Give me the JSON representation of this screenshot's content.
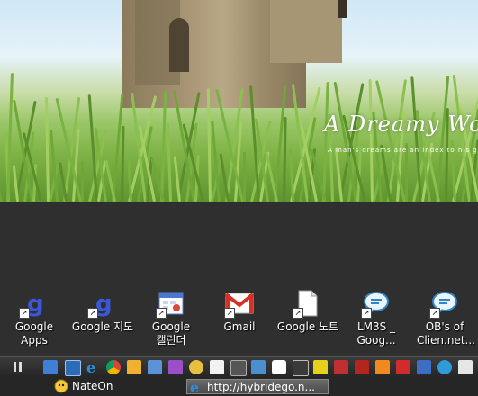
{
  "wallpaper": {
    "title": "A Dreamy Wor",
    "subtitle": "A man's dreams are an index to his grea"
  },
  "desktop_icons": [
    {
      "label": "Google Apps",
      "icon": "google-apps-icon"
    },
    {
      "label": "Google 지도",
      "icon": "google-maps-icon"
    },
    {
      "label": "Google 캘린더",
      "icon": "google-calendar-icon"
    },
    {
      "label": "Gmail",
      "icon": "gmail-icon"
    },
    {
      "label": "Google 노트",
      "icon": "google-notebook-icon"
    },
    {
      "label": "LM3S _ Goog...",
      "icon": "chat-bubble-icon"
    },
    {
      "label": "OB's of Clien.net...",
      "icon": "chat-bubble-icon"
    }
  ],
  "taskbar": {
    "tasks": [
      {
        "label": "NateOn",
        "icon": "nateon-icon"
      },
      {
        "label": "http://hybridego.n...",
        "icon": "internet-explorer-icon"
      }
    ]
  },
  "colors": {
    "taskbar": "#262626",
    "desktop": "#2f2f2f",
    "gmail_red": "#d93025",
    "google_blue": "#3b57d6"
  }
}
